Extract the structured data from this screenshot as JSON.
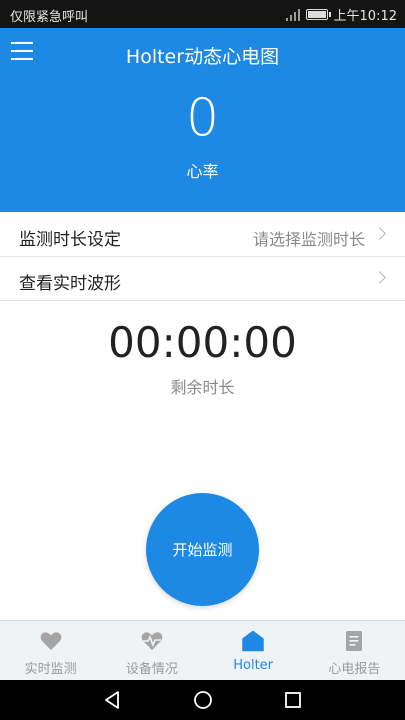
{
  "status_bar": {
    "carrier_text": "仅限紧急呼叫",
    "time": "上午10:12",
    "icons": [
      "signal-icon",
      "battery-icon"
    ]
  },
  "header": {
    "title": "Holter动态心电图",
    "heart_rate": "0",
    "heart_rate_label": "心率",
    "background_color": "#1e88e5"
  },
  "settings": {
    "duration_label": "监测时长设定",
    "duration_value": "请选择监测时长",
    "waveform_label": "查看实时波形"
  },
  "timer": {
    "value": "00:00:00",
    "label": "剩余时长"
  },
  "start_button": {
    "label": "开始监测"
  },
  "tabs": [
    {
      "label": "实时监测",
      "icon": "heart-icon",
      "active": false
    },
    {
      "label": "设备情况",
      "icon": "heart-pulse-icon",
      "active": false
    },
    {
      "label": "Holter",
      "icon": "home-icon",
      "active": true
    },
    {
      "label": "心电报告",
      "icon": "document-icon",
      "active": false
    }
  ],
  "colors": {
    "accent": "#1e88e5",
    "inactive_tab": "#9a9a9a"
  }
}
